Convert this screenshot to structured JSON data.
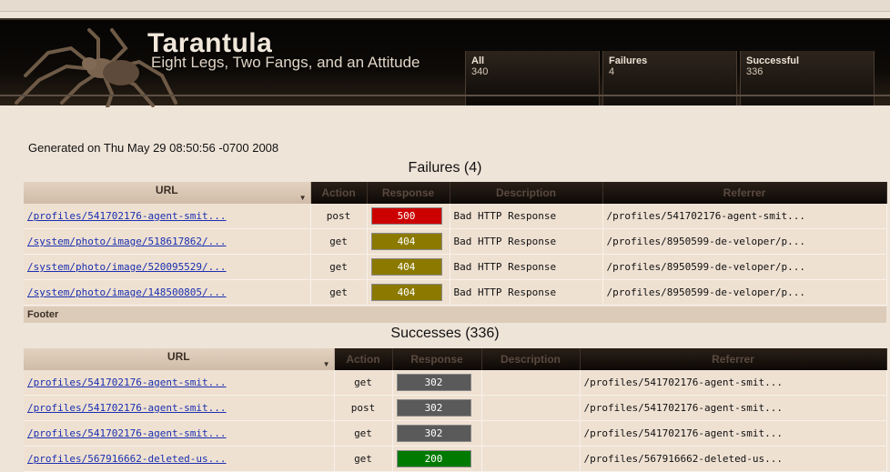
{
  "header": {
    "title": "Tarantula",
    "tagline": "Eight Legs, Two Fangs, and an Attitude",
    "tabs": [
      {
        "label": "All",
        "count": "340"
      },
      {
        "label": "Failures",
        "count": "4"
      },
      {
        "label": "Successful",
        "count": "336"
      }
    ]
  },
  "generated": "Generated on Thu May 29 08:50:56 -0700 2008",
  "columns": {
    "url": "URL",
    "action": "Action",
    "response": "Response",
    "description": "Description",
    "referrer": "Referrer"
  },
  "failures": {
    "title": "Failures (4)",
    "rows": [
      {
        "url": "/profiles/541702176-agent-smit...",
        "action": "post",
        "code": "500",
        "code_color": "#cc0000",
        "description": "Bad HTTP Response",
        "referrer": "/profiles/541702176-agent-smit..."
      },
      {
        "url": "/system/photo/image/518617862/...",
        "action": "get",
        "code": "404",
        "code_color": "#8c7a00",
        "description": "Bad HTTP Response",
        "referrer": "/profiles/8950599-de-veloper/p..."
      },
      {
        "url": "/system/photo/image/520095529/...",
        "action": "get",
        "code": "404",
        "code_color": "#8c7a00",
        "description": "Bad HTTP Response",
        "referrer": "/profiles/8950599-de-veloper/p..."
      },
      {
        "url": "/system/photo/image/148500805/...",
        "action": "get",
        "code": "404",
        "code_color": "#8c7a00",
        "description": "Bad HTTP Response",
        "referrer": "/profiles/8950599-de-veloper/p..."
      }
    ]
  },
  "footer": "Footer",
  "successes": {
    "title": "Successes (336)",
    "rows": [
      {
        "url": "/profiles/541702176-agent-smit...",
        "action": "get",
        "code": "302",
        "code_color": "#5a5a5a",
        "description": "",
        "referrer": "/profiles/541702176-agent-smit..."
      },
      {
        "url": "/profiles/541702176-agent-smit...",
        "action": "post",
        "code": "302",
        "code_color": "#5a5a5a",
        "description": "",
        "referrer": "/profiles/541702176-agent-smit..."
      },
      {
        "url": "/profiles/541702176-agent-smit...",
        "action": "get",
        "code": "302",
        "code_color": "#5a5a5a",
        "description": "",
        "referrer": "/profiles/541702176-agent-smit..."
      },
      {
        "url": "/profiles/567916662-deleted-us...",
        "action": "get",
        "code": "200",
        "code_color": "#007a00",
        "description": "",
        "referrer": "/profiles/567916662-deleted-us..."
      }
    ]
  }
}
